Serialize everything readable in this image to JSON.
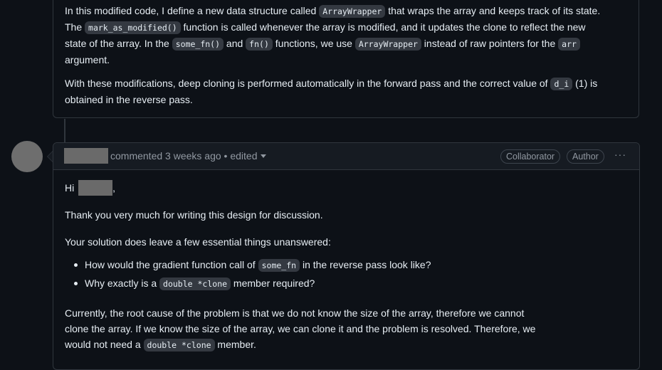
{
  "previous_comment": {
    "p1": {
      "t1": "In this modified code, I define a new data structure called ",
      "c1": "ArrayWrapper",
      "t2": " that wraps the array and keeps track of its state.",
      "t3": "The ",
      "c2": "mark_as_modified()",
      "t4": " function is called whenever the array is modified, and it updates the clone to reflect the new",
      "t5": "state of the array. In the ",
      "c3": "some_fn()",
      "t6": " and ",
      "c4": "fn()",
      "t7": " functions, we use ",
      "c5": "ArrayWrapper",
      "t8": " instead of raw pointers for the ",
      "c6": "arr",
      "t9": "argument."
    },
    "p2": {
      "t1": "With these modifications, deep cloning is performed automatically in the forward pass and the correct value of ",
      "c1": "d_i",
      "t2": " (1) is",
      "t3": "obtained in the reverse pass."
    }
  },
  "comment": {
    "header": {
      "commented": "commented",
      "time": "3 weeks ago",
      "separator": "•",
      "edited": "edited",
      "badge_collaborator": "Collaborator",
      "badge_author": "Author",
      "more": "···"
    },
    "greeting": "Hi",
    "greeting_suffix": ",",
    "thanks": "Thank you very much for writing this design for discussion.",
    "intro": "Your solution does leave a few essential things unanswered:",
    "bullets": [
      {
        "t1": "How would the gradient function call of ",
        "code": "some_fn",
        "t2": " in the reverse pass look like?"
      },
      {
        "t1": "Why exactly is a ",
        "code": "double *clone",
        "t2": " member required?"
      }
    ],
    "closing": {
      "l1": "Currently, the root cause of the problem is that we do not know the size of the array, therefore we cannot",
      "l2": "clone the array. If we know the size of the array, we can clone it and the problem is resolved. Therefore, we",
      "l3a": "would not need a ",
      "code": "double *clone",
      "l3b": " member."
    }
  }
}
